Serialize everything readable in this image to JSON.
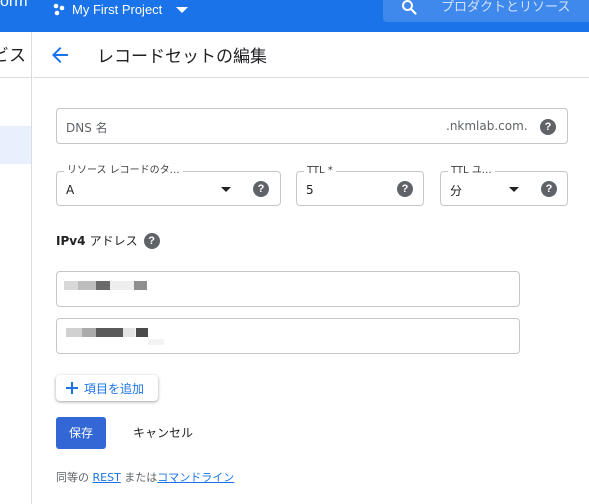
{
  "app": {
    "brand_fragment": "orm",
    "project_name": "My First Project",
    "search_placeholder": "プロダクトとリソース"
  },
  "nav": {
    "title_fragment": "ビス"
  },
  "header": {
    "title": "レコードセットの編集"
  },
  "form": {
    "dns_name_placeholder": "DNS 名",
    "dns_suffix": ".nkmlab.com.",
    "record_type": {
      "label": "リソース レコードのタ…",
      "value": "A"
    },
    "ttl": {
      "label": "TTL *",
      "value": "5"
    },
    "ttl_unit": {
      "label": "TTL ユ…",
      "value": "分"
    },
    "ipv4_label": "IPv4",
    "ipv4_label_suffix": "アドレス",
    "add_item_label": "項目を追加",
    "save_label": "保存",
    "cancel_label": "キャンセル"
  },
  "footer": {
    "prefix": "同等の",
    "rest_link": "REST",
    "middle": "または",
    "cli_link": "コマンドライン"
  },
  "colors": {
    "brand_blue": "#1a73e8",
    "primary_button": "#3367d6",
    "border": "#dadce0"
  }
}
